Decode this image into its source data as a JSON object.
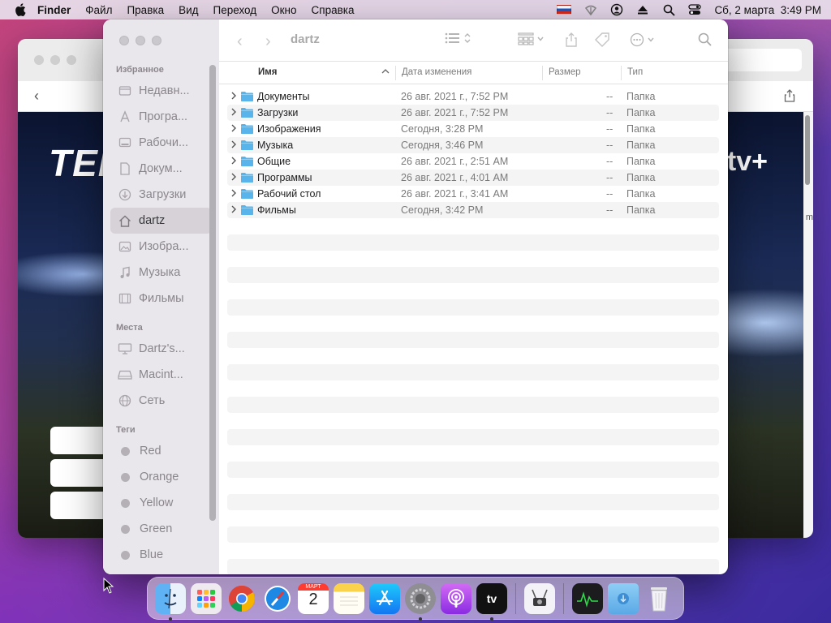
{
  "menubar": {
    "app": "Finder",
    "items": [
      "Файл",
      "Правка",
      "Вид",
      "Переход",
      "Окно",
      "Справка"
    ],
    "clock": "Сб, 2 марта  3:49 PM"
  },
  "background_window": {
    "hero_title": "TEI",
    "brand": "stv+",
    "side_letter": "m"
  },
  "finder": {
    "title": "dartz",
    "sidebar": {
      "favorites_label": "Избранное",
      "favorites": [
        {
          "label": "Недавн...",
          "icon": "clock-icon"
        },
        {
          "label": "Програ...",
          "icon": "applications-icon"
        },
        {
          "label": "Рабочи...",
          "icon": "desktop-icon"
        },
        {
          "label": "Докум...",
          "icon": "document-icon"
        },
        {
          "label": "Загрузки",
          "icon": "download-icon"
        },
        {
          "label": "dartz",
          "icon": "home-icon",
          "active": true
        },
        {
          "label": "Изобра...",
          "icon": "photo-icon"
        },
        {
          "label": "Музыка",
          "icon": "music-icon"
        },
        {
          "label": "Фильмы",
          "icon": "film-icon"
        }
      ],
      "locations_label": "Места",
      "locations": [
        {
          "label": "Dartz's...",
          "icon": "computer-icon"
        },
        {
          "label": "Macint...",
          "icon": "disk-icon"
        },
        {
          "label": "Сеть",
          "icon": "network-icon"
        }
      ],
      "tags_label": "Теги",
      "tags": [
        "Red",
        "Orange",
        "Yellow",
        "Green",
        "Blue"
      ]
    },
    "columns": {
      "name": "Имя",
      "date": "Дата изменения",
      "size": "Размер",
      "kind": "Тип"
    },
    "rows": [
      {
        "name": "Документы",
        "date": "26 авг. 2021 г., 7:52 PM",
        "size": "--",
        "kind": "Папка"
      },
      {
        "name": "Загрузки",
        "date": "26 авг. 2021 г., 7:52 PM",
        "size": "--",
        "kind": "Папка"
      },
      {
        "name": "Изображения",
        "date": "Сегодня, 3:28 PM",
        "size": "--",
        "kind": "Папка"
      },
      {
        "name": "Музыка",
        "date": "Сегодня, 3:46 PM",
        "size": "--",
        "kind": "Папка"
      },
      {
        "name": "Общие",
        "date": "26 авг. 2021 г., 2:51 AM",
        "size": "--",
        "kind": "Папка"
      },
      {
        "name": "Программы",
        "date": "26 авг. 2021 г., 4:01 AM",
        "size": "--",
        "kind": "Папка"
      },
      {
        "name": "Рабочий стол",
        "date": "26 авг. 2021 г., 3:41 AM",
        "size": "--",
        "kind": "Папка"
      },
      {
        "name": "Фильмы",
        "date": "Сегодня, 3:42 PM",
        "size": "--",
        "kind": "Папка"
      }
    ]
  },
  "dock": {
    "calendar_month": "МАРТ",
    "calendar_day": "2",
    "tv_label": "tv"
  },
  "colors": {
    "folder": "#5ab4ec",
    "flag_blue": "#1c57c4",
    "flag_red": "#d52b1e"
  }
}
